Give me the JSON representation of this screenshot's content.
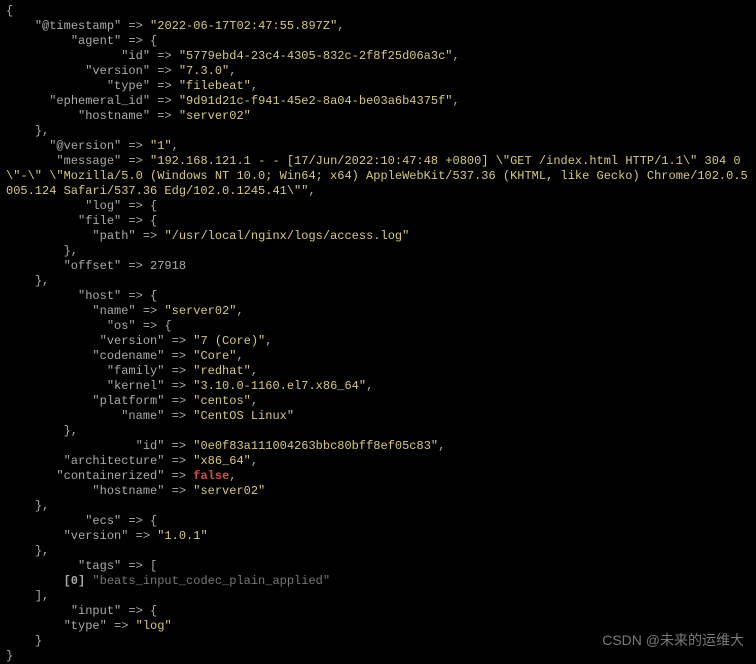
{
  "timestamp": "2022-06-17T02:47:55.897Z",
  "agent": {
    "id": "5779ebd4-23c4-4305-832c-2f8f25d06a3c",
    "version": "7.3.0",
    "type": "filebeat",
    "ephemeral_id": "9d91d21c-f941-45e2-8a04-be03a6b4375f",
    "hostname": "server02"
  },
  "version_top": "1",
  "message": "192.168.121.1 - - [17/Jun/2022:10:47:48 +0800] \\\"GET /index.html HTTP/1.1\\\" 304 0 \\\"-\\\" \\\"Mozilla/5.0 (Windows NT 10.0; Win64; x64) AppleWebKit/537.36 (KHTML, like Gecko) Chrome/102.0.5005.124 Safari/537.36 Edg/102.0.1245.41\\\"",
  "log_file_path": "/usr/local/nginx/logs/access.log",
  "offset": "27918",
  "host": {
    "name": "server02",
    "os": {
      "version": "7 (Core)",
      "codename": "Core",
      "family": "redhat",
      "kernel": "3.10.0-1160.el7.x86_64",
      "platform": "centos",
      "name": "CentOS Linux"
    },
    "id": "0e0f83a111004263bbc80bff8ef05c83",
    "architecture": "x86_64",
    "containerized": "false",
    "hostname": "server02"
  },
  "ecs_version": "1.0.1",
  "tag0": "beats_input_codec_plain_applied",
  "input_type": "log",
  "watermark": "CSDN @未来的运维大"
}
